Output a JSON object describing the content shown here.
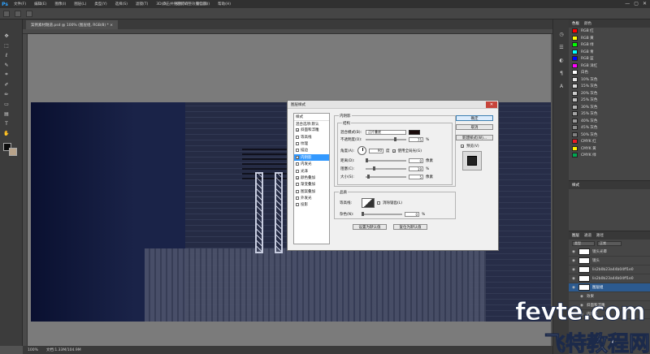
{
  "app": {
    "logo": "Ps"
  },
  "menu": [
    "文件(F)",
    "编辑(E)",
    "图像(I)",
    "图层(L)",
    "类型(Y)",
    "选择(S)",
    "滤镜(T)",
    "3D(D)",
    "视图(V)",
    "窗口(W)",
    "帮助(H)"
  ],
  "workspace_label": "点击并拖移可调整效果位置。",
  "window_controls": [
    "—",
    "▢",
    "✕"
  ],
  "document_tab": "案例素材隧道.psd @ 100% (图层组, RGB/8) * ×",
  "status": {
    "zoom": "100%",
    "doc_size": "文档:1.33M/104.9M"
  },
  "swatches_panel": {
    "tabs": [
      "色板",
      "颜色"
    ],
    "items": [
      {
        "name": "RGB 红",
        "color": "#ff0000"
      },
      {
        "name": "RGB 黄",
        "color": "#ffff00"
      },
      {
        "name": "RGB 绿",
        "color": "#00ff00"
      },
      {
        "name": "RGB 青",
        "color": "#00ffff"
      },
      {
        "name": "RGB 蓝",
        "color": "#0000ff"
      },
      {
        "name": "RGB 洋红",
        "color": "#ff00ff"
      },
      {
        "name": "白色",
        "color": "#ffffff"
      },
      {
        "name": "10% 灰色",
        "color": "#e6e6e6"
      },
      {
        "name": "15% 灰色",
        "color": "#d9d9d9"
      },
      {
        "name": "20% 灰色",
        "color": "#cccccc"
      },
      {
        "name": "25% 灰色",
        "color": "#bfbfbf"
      },
      {
        "name": "30% 灰色",
        "color": "#b3b3b3"
      },
      {
        "name": "35% 灰色",
        "color": "#a6a6a6"
      },
      {
        "name": "40% 灰色",
        "color": "#999999"
      },
      {
        "name": "45% 灰色",
        "color": "#8c8c8c"
      },
      {
        "name": "50% 灰色",
        "color": "#808080"
      },
      {
        "name": "CMYK 红",
        "color": "#ed1c24"
      },
      {
        "name": "CMYK 黄",
        "color": "#fff200"
      },
      {
        "name": "CMYK 绿",
        "color": "#00a651"
      }
    ]
  },
  "styles_panel": {
    "tab": "样式"
  },
  "layers_panel": {
    "tabs": [
      "图层",
      "通道",
      "路径"
    ],
    "kind": "类型",
    "mode": "正常",
    "rows": [
      {
        "label": "镜头光晕",
        "selected": false
      },
      {
        "label": "镜头",
        "selected": false
      },
      {
        "label": "lis2b0b23a44b04ff1e0",
        "selected": false
      },
      {
        "label": "lis2b0b23a44b04ff1e0",
        "selected": false
      },
      {
        "label": "图层组",
        "selected": true
      },
      {
        "label": "效果",
        "selected": false
      },
      {
        "label": "斜面和浮雕",
        "selected": false
      },
      {
        "label": "内阴影",
        "selected": false
      }
    ]
  },
  "dialog": {
    "title": "图层样式",
    "close": "✕",
    "styles_head": "样式",
    "blend_options": "混合选项:默认",
    "style_items": [
      {
        "label": "斜面和浮雕",
        "checked": true,
        "selected": false
      },
      {
        "label": "等高线",
        "checked": false,
        "selected": false
      },
      {
        "label": "纹理",
        "checked": false,
        "selected": false
      },
      {
        "label": "描边",
        "checked": false,
        "selected": false
      },
      {
        "label": "内阴影",
        "checked": true,
        "selected": true
      },
      {
        "label": "内发光",
        "checked": false,
        "selected": false
      },
      {
        "label": "光泽",
        "checked": false,
        "selected": false
      },
      {
        "label": "颜色叠加",
        "checked": true,
        "selected": false
      },
      {
        "label": "渐变叠加",
        "checked": false,
        "selected": false
      },
      {
        "label": "图案叠加",
        "checked": false,
        "selected": false
      },
      {
        "label": "外发光",
        "checked": false,
        "selected": false
      },
      {
        "label": "投影",
        "checked": false,
        "selected": false
      }
    ],
    "inner_shadow": {
      "section": "内阴影",
      "structure": "结构",
      "blend_mode_label": "混合模式(B):",
      "blend_mode_value": "正片叠底",
      "shadow_color": "#1a0a0a",
      "opacity_label": "不透明度(O):",
      "opacity_value": "75",
      "opacity_fraction": 0.75,
      "angle_label": "角度(A):",
      "angle_value": "90",
      "angle_unit": "度",
      "global_light": "使用全局光(G)",
      "distance_label": "距离(D):",
      "distance_value": "0",
      "choke_label": "阻塞(C):",
      "choke_value": "19",
      "size_label": "大小(S):",
      "size_value": "5",
      "unit_px": "像素",
      "unit_pct": "%"
    },
    "quality": {
      "section": "品质",
      "contour_label": "等高线:",
      "antialias": "消除锯齿(L)",
      "noise_label": "杂色(N):",
      "noise_value": "0"
    },
    "btn_default": "设置为默认值",
    "btn_reset": "复位为默认值",
    "ok": "确定",
    "cancel": "取消",
    "new_style": "新建样式(W)...",
    "preview": "预览(V)"
  },
  "watermark": {
    "top": "fevte.com",
    "bottom": "飞特教程网"
  }
}
